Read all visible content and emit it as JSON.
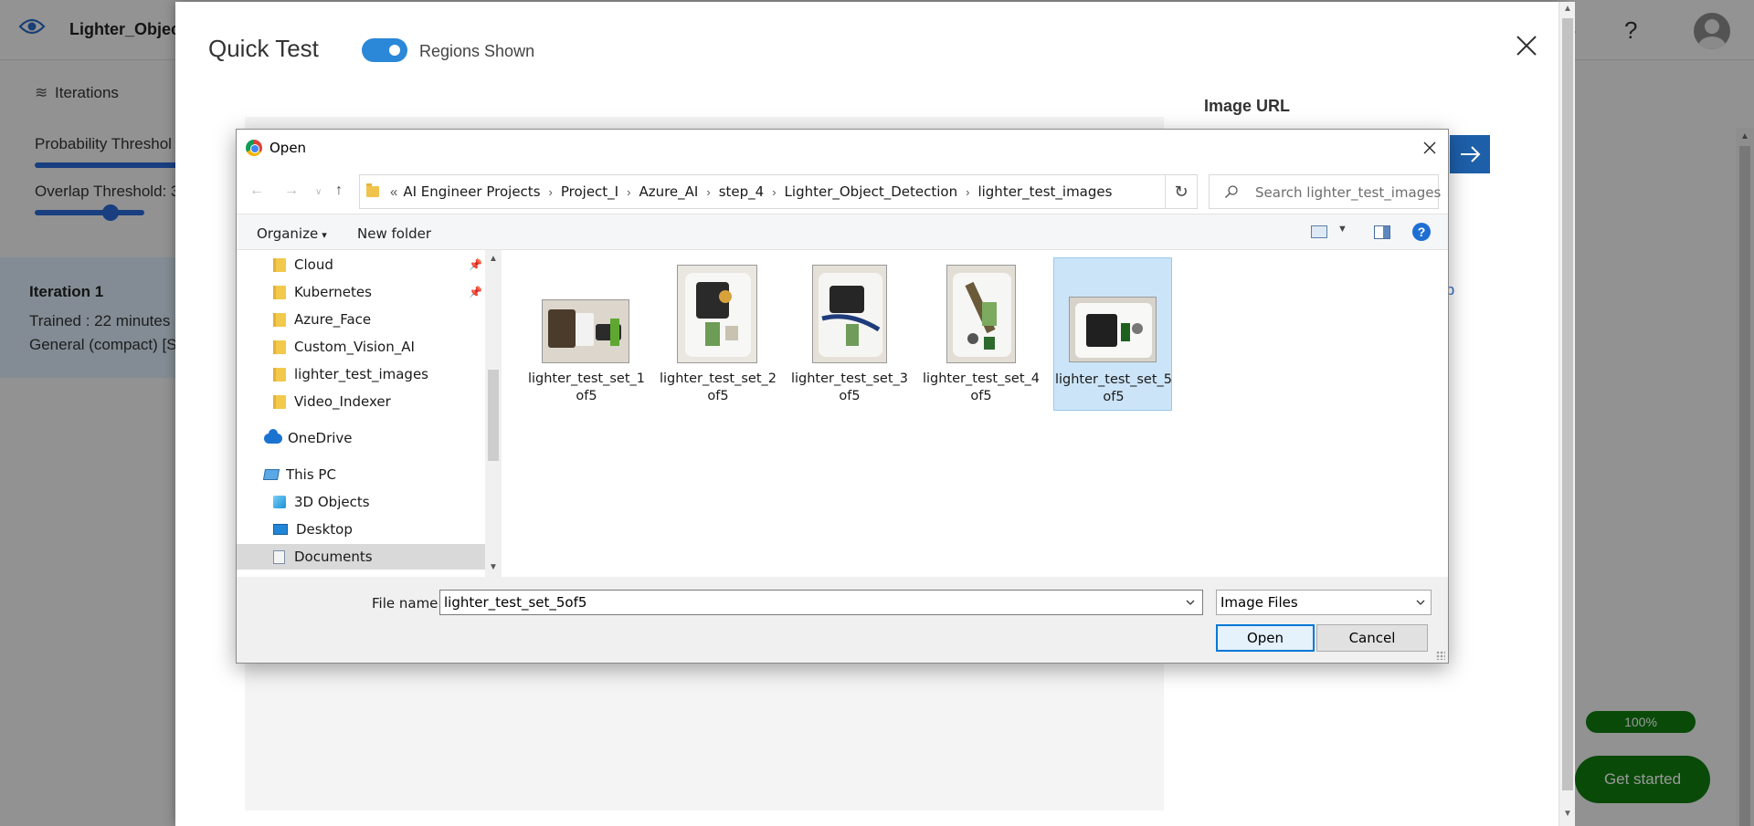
{
  "background_app": {
    "project_name": "Lighter_Object",
    "iterations_label": "Iterations",
    "probability_label": "Probability Threshol",
    "overlap_label": "Overlap Threshold: 3",
    "iteration_title": "Iteration 1",
    "iteration_trained": "Trained : 22 minutes",
    "iteration_general": "General (compact) [S",
    "help": "?",
    "edge_letter": "s",
    "progress_label": "100%",
    "get_started_label": "Get started"
  },
  "quick_test": {
    "title": "Quick Test",
    "toggle_label": "Regions Shown",
    "toggle_on": true,
    "image_url_label": "Image URL",
    "browse_link_fragment": "ıp"
  },
  "open_dialog": {
    "title": "Open",
    "breadcrumb_lead": "«",
    "breadcrumb": [
      "AI Engineer Projects",
      "Project_I",
      "Azure_AI",
      "step_4",
      "Lighter_Object_Detection",
      "lighter_test_images"
    ],
    "search_placeholder": "Search lighter_test_images",
    "toolbar": {
      "organize": "Organize",
      "new_folder": "New folder",
      "help": "?"
    },
    "nav_items": [
      {
        "label": "Cloud",
        "icon": "folder-icon",
        "pinned": true
      },
      {
        "label": "Kubernetes",
        "icon": "folder-icon",
        "pinned": true
      },
      {
        "label": "Azure_Face",
        "icon": "folder-icon"
      },
      {
        "label": "Custom_Vision_AI",
        "icon": "folder-icon"
      },
      {
        "label": "lighter_test_images",
        "icon": "folder-icon"
      },
      {
        "label": "Video_Indexer",
        "icon": "folder-icon"
      },
      {
        "label": "OneDrive",
        "icon": "cloud-icon"
      },
      {
        "label": "This PC",
        "icon": "pc-icon"
      },
      {
        "label": "3D Objects",
        "icon": "cube-icon"
      },
      {
        "label": "Desktop",
        "icon": "desktop-icon"
      },
      {
        "label": "Documents",
        "icon": "documents-icon",
        "selected": true
      }
    ],
    "files": [
      {
        "line1": "lighter_test_set_1",
        "line2": "of5",
        "selected": false
      },
      {
        "line1": "lighter_test_set_2",
        "line2": "of5",
        "selected": false
      },
      {
        "line1": "lighter_test_set_3",
        "line2": "of5",
        "selected": false
      },
      {
        "line1": "lighter_test_set_4",
        "line2": "of5",
        "selected": false
      },
      {
        "line1": "lighter_test_set_5",
        "line2": "of5",
        "selected": true
      }
    ],
    "file_name_label": "File name:",
    "file_name_value": "lighter_test_set_5of5",
    "file_type_value": "Image Files",
    "open_button": "Open",
    "cancel_button": "Cancel"
  },
  "colors": {
    "accent_blue": "#2b88d8",
    "selection_bg": "#cce4f7",
    "success_green": "#107c10"
  }
}
